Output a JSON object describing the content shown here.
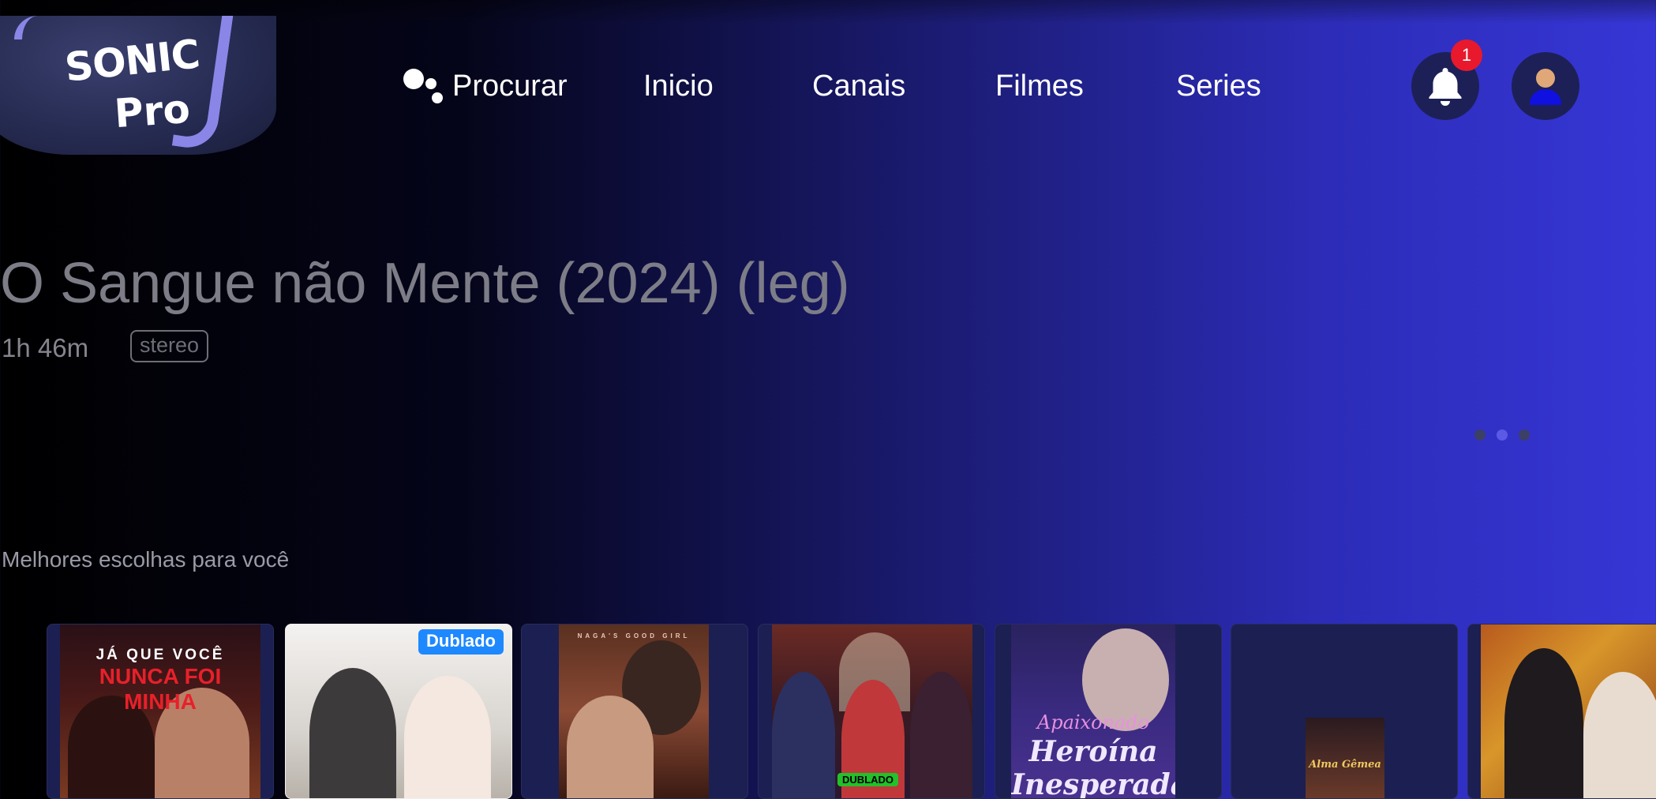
{
  "app": {
    "logo_line1": "SONIC",
    "logo_line2": "Pro"
  },
  "nav": {
    "search_label": "Procurar",
    "items": [
      {
        "label": "Inicio"
      },
      {
        "label": "Canais"
      },
      {
        "label": "Filmes"
      },
      {
        "label": "Series"
      }
    ]
  },
  "notifications": {
    "count": "1",
    "icon": "bell-icon"
  },
  "profile": {
    "icon": "user-icon"
  },
  "hero": {
    "title": "O Sangue não Mente (2024) (leg)",
    "duration": "1h 46m",
    "audio_tag": "stereo",
    "pager": {
      "total": 3,
      "active_index": 1
    }
  },
  "section": {
    "title": "Melhores escolhas para você",
    "cards": [
      {
        "caption_top": "JÁ QUE VOCÊ",
        "caption_main": "NUNCA FOI MINHA",
        "badge": ""
      },
      {
        "caption_top": "",
        "caption_main": "",
        "badge": "Dublado"
      },
      {
        "caption_top": "NAGA'S GOOD GIRL",
        "caption_main": "",
        "badge": ""
      },
      {
        "caption_top": "",
        "caption_main": "",
        "badge": "DUBLADO"
      },
      {
        "caption_top": "Apaixonado",
        "caption_main": "Heroína Inesperada",
        "badge": ""
      },
      {
        "caption_top": "",
        "caption_main": "Alma Gêmea",
        "badge": ""
      },
      {
        "caption_top": "",
        "caption_main": "",
        "badge": ""
      }
    ]
  },
  "colors": {
    "accent": "#5a5ae6",
    "badge_red": "#e8192c",
    "badge_blue": "#1e88ff",
    "badge_green": "#22c02a"
  }
}
